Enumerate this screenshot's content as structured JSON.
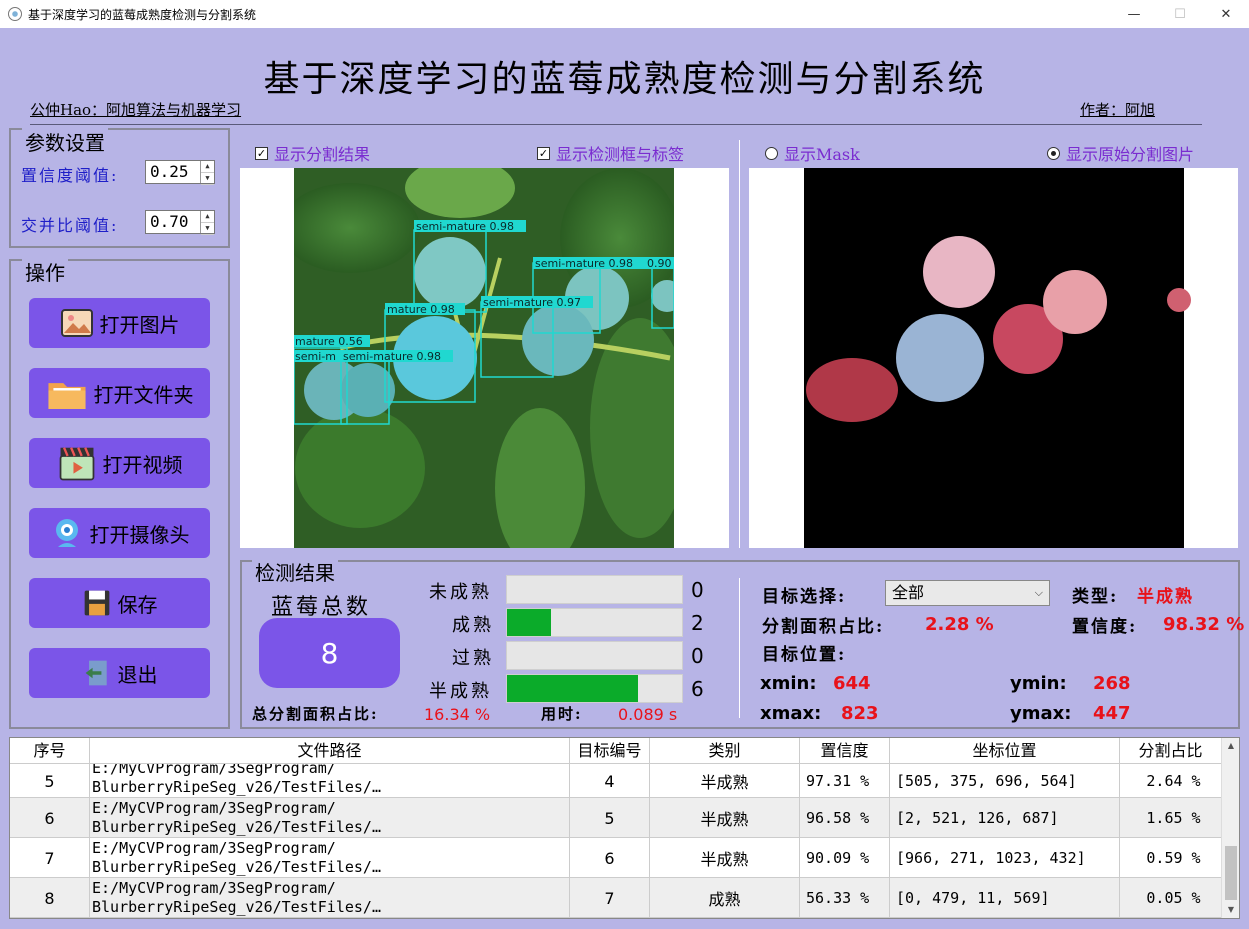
{
  "window": {
    "title": "基于深度学习的蓝莓成熟度检测与分割系统",
    "min": "—",
    "max": "☐",
    "close": "✕"
  },
  "header": {
    "title": "基于深度学习的蓝莓成熟度检测与分割系统",
    "left_sub": "公仲Hao：阿旭算法与机器学习",
    "right_sub": "作者：阿旭"
  },
  "params": {
    "title": "参数设置",
    "conf_label": "置信度阈值:",
    "conf_value": "0.25",
    "iou_label": "交并比阈值:",
    "iou_value": "0.70"
  },
  "ops": {
    "title": "操作",
    "buttons": [
      {
        "label": "打开图片",
        "icon": "image-icon"
      },
      {
        "label": "打开文件夹",
        "icon": "folder-icon"
      },
      {
        "label": "打开视频",
        "icon": "video-icon"
      },
      {
        "label": "打开摄像头",
        "icon": "camera-icon"
      },
      {
        "label": "保存",
        "icon": "save-icon"
      },
      {
        "label": "退出",
        "icon": "exit-icon"
      }
    ]
  },
  "view_opts": {
    "show_seg": "显示分割结果",
    "show_box": "显示检测框与标签",
    "show_mask": "显示Mask",
    "show_orig": "显示原始分割图片"
  },
  "detections": [
    {
      "label": "semi-mature 0.98"
    },
    {
      "label": "semi-mature 0.98"
    },
    {
      "label": "0.90"
    },
    {
      "label": "semi-mature 0.97"
    },
    {
      "label": "mature 0.98"
    },
    {
      "label": "mature 0.56"
    },
    {
      "label": "semi-m"
    },
    {
      "label": "semi-mature 0.98"
    }
  ],
  "results": {
    "title": "检测结果",
    "total_label": "蓝莓总数",
    "total_value": "8",
    "rows": [
      {
        "label": "未成熟",
        "count": "0",
        "fraction": 0.0
      },
      {
        "label": "成熟",
        "count": "2",
        "fraction": 0.25
      },
      {
        "label": "过熟",
        "count": "0",
        "fraction": 0.0
      },
      {
        "label": "半成熟",
        "count": "6",
        "fraction": 0.75
      }
    ],
    "area_label": "总分割面积占比:",
    "area_value": "16.34 %",
    "time_label": "用时:",
    "time_value": "0.089 s"
  },
  "target": {
    "select_label": "目标选择:",
    "select_value": "全部",
    "type_label": "类型:",
    "type_value": "半成熟",
    "seg_ratio_label": "分割面积占比:",
    "seg_ratio_value": "2.28 %",
    "conf_label": "置信度:",
    "conf_value": "98.32 %",
    "pos_label": "目标位置:",
    "xmin_label": "xmin:",
    "xmin": "644",
    "ymin_label": "ymin:",
    "ymin": "268",
    "xmax_label": "xmax:",
    "xmax": "823",
    "ymax_label": "ymax:",
    "ymax": "447"
  },
  "table": {
    "headers": [
      "序号",
      "文件路径",
      "目标编号",
      "类别",
      "置信度",
      "坐标位置",
      "分割占比"
    ],
    "rows": [
      {
        "idx": "5",
        "path": "E:/MyCVProgram/3SegProgram/\nBlurberryRipeSeg_v26/TestFiles/…",
        "target": "4",
        "cls": "半成熟",
        "conf": "97.31 %",
        "pos": "[505, 375, 696, 564]",
        "ratio": "2.64 %"
      },
      {
        "idx": "6",
        "path": "E:/MyCVProgram/3SegProgram/\nBlurberryRipeSeg_v26/TestFiles/…",
        "target": "5",
        "cls": "半成熟",
        "conf": "96.58 %",
        "pos": "[2, 521, 126, 687]",
        "ratio": "1.65 %"
      },
      {
        "idx": "7",
        "path": "E:/MyCVProgram/3SegProgram/\nBlurberryRipeSeg_v26/TestFiles/…",
        "target": "6",
        "cls": "半成熟",
        "conf": "90.09 %",
        "pos": "[966, 271, 1023, 432]",
        "ratio": "0.59 %"
      },
      {
        "idx": "8",
        "path": "E:/MyCVProgram/3SegProgram/\nBlurberryRipeSeg_v26/TestFiles/…",
        "target": "7",
        "cls": "成熟",
        "conf": "56.33 %",
        "pos": "[0, 479, 11, 569]",
        "ratio": "0.05 %"
      }
    ]
  }
}
